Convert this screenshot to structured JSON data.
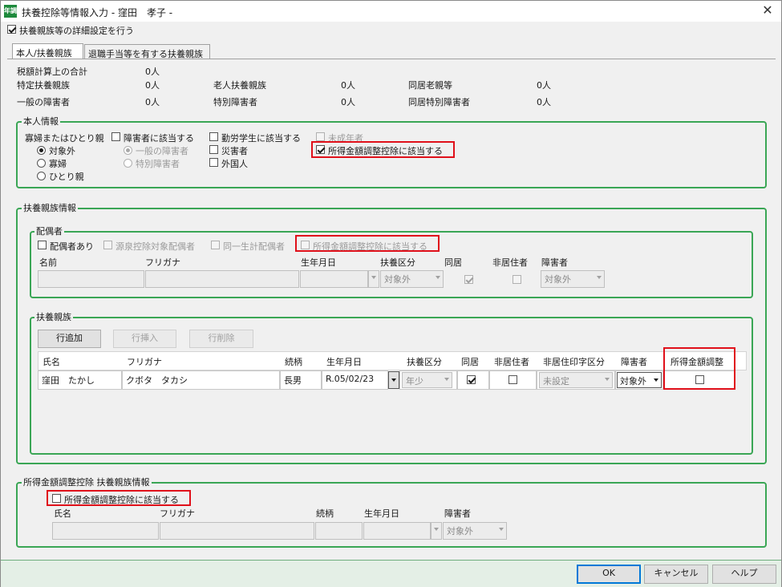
{
  "window": {
    "title": "扶養控除等情報入力 - 窪田　孝子 -",
    "icon_label": "年調",
    "close": "✕"
  },
  "detail_setting": {
    "label": "扶養親族等の詳細設定を行う",
    "checked": true
  },
  "tabs": [
    {
      "label": "本人/扶養親族",
      "active": true
    },
    {
      "label": "退職手当等を有する扶養親族",
      "active": false
    }
  ],
  "summary": {
    "tax_total_label": "税額計算上の合計",
    "tax_total_value": "0人",
    "tokutei_label": "特定扶養親族",
    "tokutei_value": "0人",
    "rojin_label": "老人扶養親族",
    "rojin_value": "0人",
    "dokyo_rojin_label": "同居老親等",
    "dokyo_rojin_value": "0人",
    "ippan_label": "一般の障害者",
    "ippan_value": "0人",
    "tokubetsu_label": "特別障害者",
    "tokubetsu_value": "0人",
    "dokyo_tokubetsu_label": "同居特別障害者",
    "dokyo_tokubetsu_value": "0人"
  },
  "honnin": {
    "title": "本人情報",
    "widow_label": "寡婦またはひとり親",
    "widow_options": [
      "対象外",
      "寡婦",
      "ひとり親"
    ],
    "disabled_label": "障害者に該当する",
    "disabled_options": [
      "一般の障害者",
      "特別障害者"
    ],
    "student_label": "勤労学生に該当する",
    "disaster_label": "災害者",
    "foreigner_label": "外国人",
    "minor_label": "未成年者",
    "income_adj_label": "所得金額調整控除に該当する"
  },
  "fuyo": {
    "title": "扶養親族情報",
    "spouse": {
      "title": "配偶者",
      "has_spouse": "配偶者あり",
      "gensen": "源泉控除対象配偶者",
      "doitsu": "同一生計配偶者",
      "income_adj": "所得金額調整控除に該当する",
      "headers": [
        "名前",
        "フリガナ",
        "生年月日",
        "扶養区分",
        "同居",
        "非居住者",
        "障害者"
      ],
      "fuyo_kubun": "対象外",
      "shogai": "対象外"
    },
    "dependents": {
      "title": "扶養親族",
      "buttons": {
        "add": "行追加",
        "insert": "行挿入",
        "delete": "行削除"
      },
      "headers": [
        "氏名",
        "フリガナ",
        "続柄",
        "生年月日",
        "扶養区分",
        "同居",
        "非居住者",
        "非居住印字区分",
        "障害者",
        "所得金額調整"
      ],
      "rows": [
        {
          "name": "窪田　たかし",
          "kana": "クボタ　タカシ",
          "relation": "長男",
          "birth": "R.05/02/23",
          "kubun": "年少",
          "dokyo": true,
          "hikyoju": false,
          "inji": "未設定",
          "shogai": "対象外",
          "income_adj": false
        }
      ]
    }
  },
  "income_adj_section": {
    "title": "所得金額調整控除 扶養親族情報",
    "checkbox": "所得金額調整控除に該当する",
    "headers": [
      "氏名",
      "フリガナ",
      "続柄",
      "生年月日",
      "障害者"
    ],
    "shogai": "対象外"
  },
  "footer": {
    "ok": "OK",
    "cancel": "キャンセル",
    "help": "ヘルプ"
  },
  "colors": {
    "group_border": "#3aa655",
    "highlight": "#e0101a",
    "footer_bg": "#e4efe6"
  }
}
